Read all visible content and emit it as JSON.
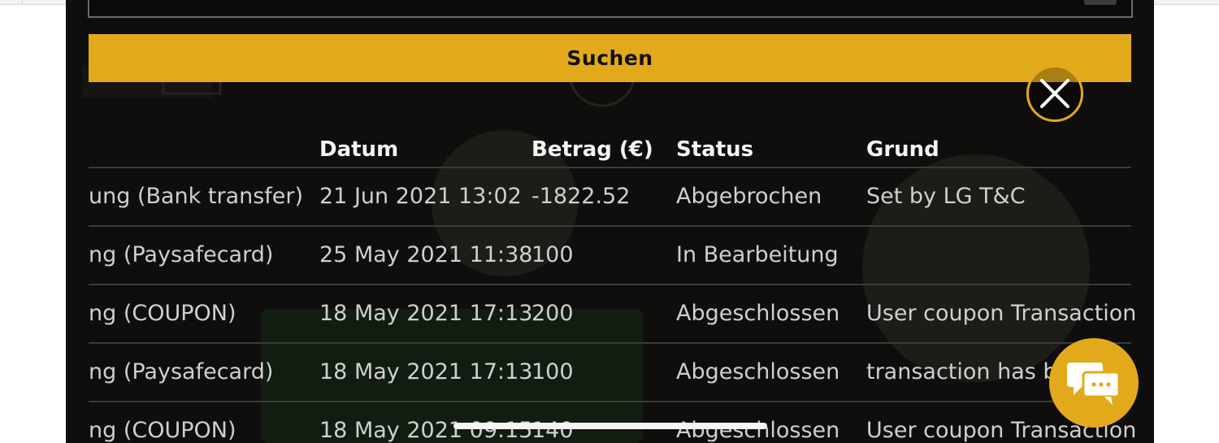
{
  "search": {
    "button_label": "Suchen"
  },
  "table": {
    "headers": {
      "date": "Datum",
      "amount": "Betrag (€)",
      "status": "Status",
      "reason": "Grund"
    },
    "rows": [
      {
        "type": "ung  (Bank transfer)",
        "date": "21 Jun 2021 13:02",
        "amount": "-1822.52",
        "status": "Abgebrochen",
        "reason": "Set by LG T&C"
      },
      {
        "type": "ng  (Paysafecard)",
        "date": "25 May 2021 11:38",
        "amount": "100",
        "status": "In Bearbeitung",
        "reason": ""
      },
      {
        "type": "ng  (COUPON)",
        "date": "18 May 2021 17:13",
        "amount": "200",
        "status": "Abgeschlossen",
        "reason": "User coupon Transaction"
      },
      {
        "type": "ng  (Paysafecard)",
        "date": "18 May 2021 17:13",
        "amount": "100",
        "status": "Abgeschlossen",
        "reason": "transaction has b"
      },
      {
        "type": "ng  (COUPON)",
        "date": "18 May 2021 09:15",
        "amount": "140",
        "status": "Abgeschlossen",
        "reason": "User coupon Transaction"
      }
    ]
  },
  "icons": {
    "close": "close-icon",
    "chat": "chat-icon"
  },
  "colors": {
    "accent": "#e2aa1b",
    "panel_bg": "#0f0e0c",
    "text": "#cfcfcf",
    "header_text": "#f4f4f4"
  }
}
